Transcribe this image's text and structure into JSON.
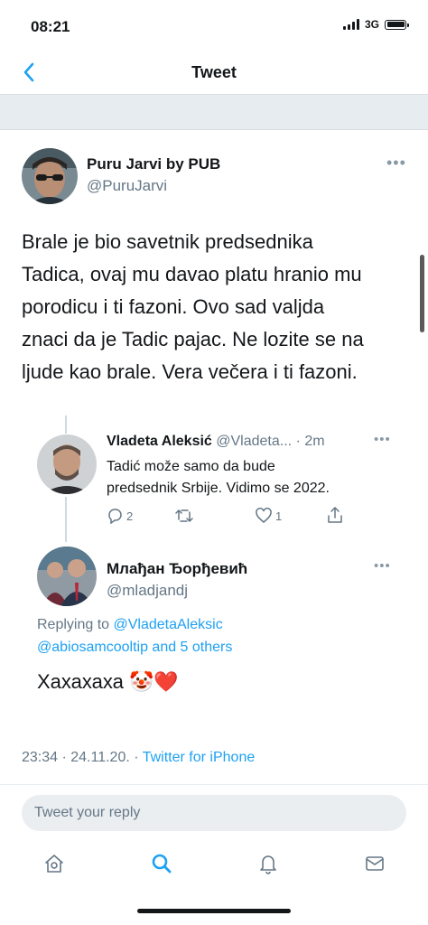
{
  "status_bar": {
    "time": "08:21",
    "network": "3G"
  },
  "nav": {
    "title": "Tweet"
  },
  "tweet": {
    "author_name": "Puru Jarvi by PUB",
    "author_handle": "@PuruJarvi",
    "lines": [
      "Brale je bio savetnik predsednika",
      "Tadica, ovaj mu davao platu hranio mu",
      "porodicu i ti fazoni. Ovo sad valjda",
      "znaci da je Tadic pajac. Ne lozite se na",
      "ljude kao brale. Vera večera i ti fazoni."
    ]
  },
  "reply1": {
    "name": "Vladeta Aleksić",
    "handle": "@Vladeta...",
    "time": "· 2m",
    "lines": [
      "Tadić može samo da bude",
      "predsednik Srbije. Vidimo se 2022."
    ],
    "reply_count": "2",
    "like_count": "1"
  },
  "reply2": {
    "name": "Млађан Ђорђевић",
    "handle": "@mladjandj",
    "replying_prefix": "Replying to ",
    "replying_to": "@VladetaAleksic",
    "replying_line2": "@abiosamcooltip and 5 others",
    "text": "Хахахаха",
    "emoji": "🤡❤️"
  },
  "meta": {
    "time": "23:34 · 24.11.20. · ",
    "source": "Twitter for iPhone"
  },
  "reply_box": {
    "placeholder": "Tweet your reply"
  },
  "icons": [
    "chevron-left-icon",
    "more-icon",
    "comment-icon",
    "retweet-icon",
    "heart-icon",
    "share-icon",
    "home-icon",
    "search-icon",
    "bell-icon",
    "mail-icon"
  ],
  "colors": {
    "accent": "#1da1f2",
    "secondary_text": "#657786",
    "band": "#e6ecf0"
  }
}
